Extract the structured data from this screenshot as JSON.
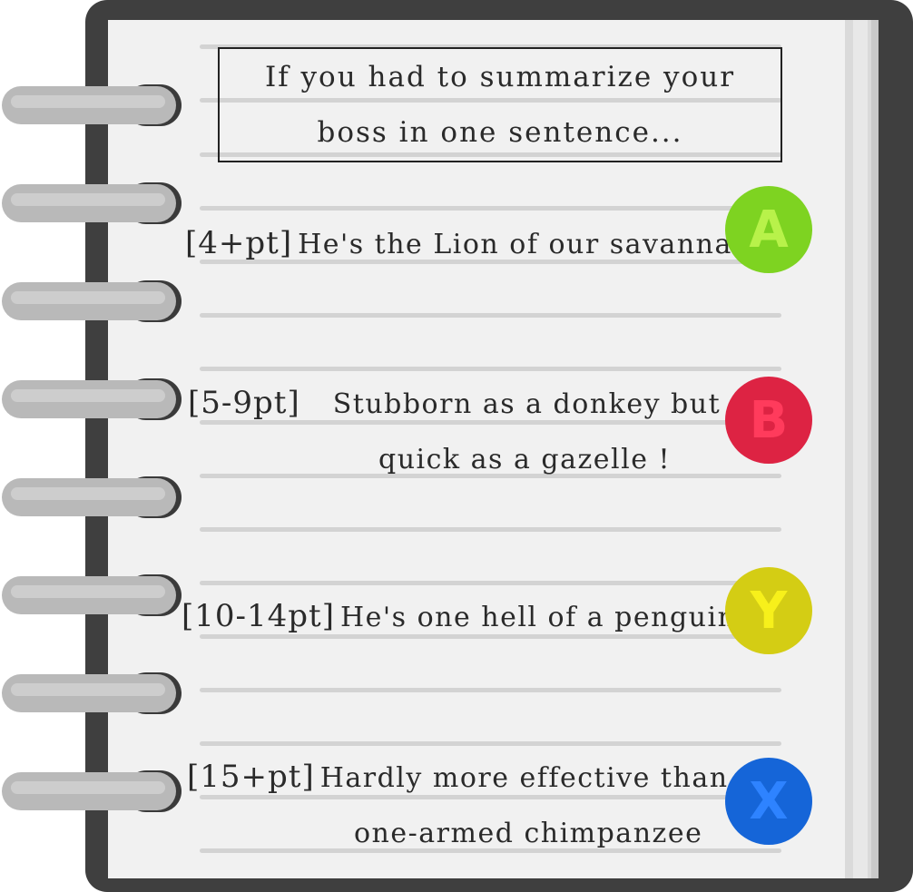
{
  "question": {
    "text": "If you had to summarize your boss in one sentence..."
  },
  "options": [
    {
      "button_letter": "A",
      "button_color": "#7ed321",
      "letter_color": "#b8f24a",
      "points": "[4+pt]",
      "text_line1": "He's the Lion of our savannah !",
      "text_line2": ""
    },
    {
      "button_letter": "B",
      "button_color": "#dd2343",
      "letter_color": "#ff3b5c",
      "points": "[5-9pt]",
      "text_line1": "Stubborn as a donkey but",
      "text_line2": "quick as a gazelle !"
    },
    {
      "button_letter": "Y",
      "button_color": "#d4cd14",
      "letter_color": "#f7f01b",
      "points": "[10-14pt]",
      "text_line1": "He's one hell of a penguin !",
      "text_line2": ""
    },
    {
      "button_letter": "X",
      "button_color": "#1565d8",
      "letter_color": "#2e83ff",
      "points": "[15+pt]",
      "text_line1": "Hardly more effective than a",
      "text_line2": "one-armed chimpanzee"
    }
  ]
}
